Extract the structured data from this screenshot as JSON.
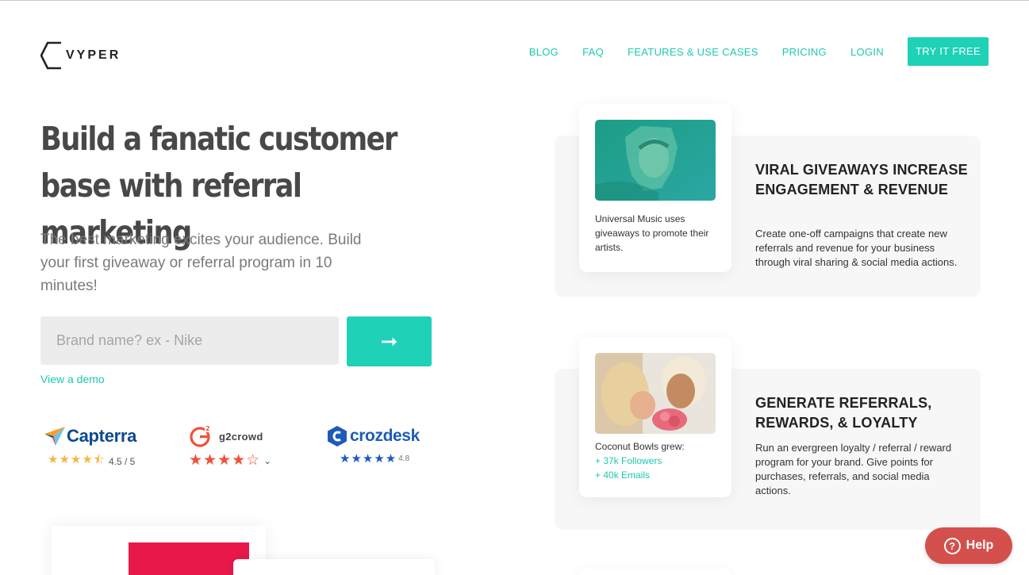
{
  "brand": {
    "logo_text": "VYPER"
  },
  "nav": {
    "items": [
      "BLOG",
      "FAQ",
      "FEATURES & USE CASES",
      "PRICING",
      "LOGIN"
    ],
    "cta": "TRY IT FREE"
  },
  "hero": {
    "headline": "Build a fanatic customer base with referral marketing",
    "subtext": "The best marketing excites your audience. Build your first giveaway or referral program in 10 minutes!",
    "input_placeholder": "Brand name? ex - Nike",
    "submit_icon": "arrow-right-icon",
    "submit_glyph": "➞",
    "demo_link": "View a demo"
  },
  "ratings": {
    "capterra": {
      "name": "Capterra",
      "stars": "★★★★⯪",
      "score": "4.5 / 5",
      "score_value": 4.5
    },
    "g2": {
      "logo_glyph": "G²",
      "name": "g2crowd",
      "stars": "★★★★☆",
      "score_value": 4.5,
      "chevron": "⌄"
    },
    "crozdesk": {
      "name": "crozdesk",
      "stars": "★★★★★",
      "score": "4.8",
      "score_value": 4.8
    }
  },
  "features": [
    {
      "caption": "Universal Music uses giveaways to promote their artists.",
      "title": "VIRAL GIVEAWAYS INCREASE ENGAGEMENT & REVENUE",
      "description": "Create one-off campaigns that create new referrals and revenue for your business through viral sharing & social media actions."
    },
    {
      "caption": "Coconut Bowls grew:",
      "stats": [
        "+ 37k Followers",
        "+ 40k Emails"
      ],
      "title": "GENERATE REFERRALS, REWARDS, & LOYALTY",
      "description": "Run an evergreen loyalty / referral / reward program for your brand. Give points for purchases, referrals, and social media actions."
    }
  ],
  "help": {
    "label": "Help",
    "glyph": "?"
  },
  "colors": {
    "accent": "#1ed1b7",
    "help": "#d3504d",
    "capterra": "#0b4a8f",
    "g2": "#f0513a",
    "crozdesk": "#1e5bb8",
    "gold": "#f4b740"
  }
}
